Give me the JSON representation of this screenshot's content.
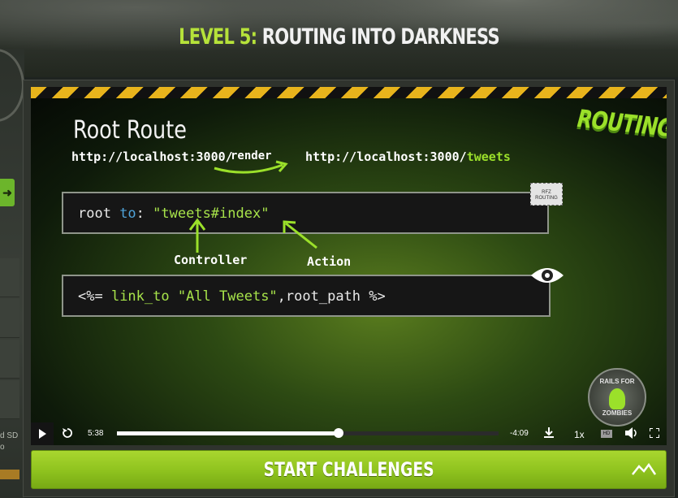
{
  "header": {
    "level_prefix": "LEVEL 5:",
    "level_name": "ROUTING INTO DARKNESS"
  },
  "sidebar": {
    "quality_text": "d SD",
    "quality_sub": "o"
  },
  "slide": {
    "title": "Root Route",
    "logo_text": "ROUTING",
    "url_from": "http://localhost:3000/",
    "render_label": "render",
    "url_to_base": "http://localhost:3000/",
    "url_to_path": "tweets",
    "code1": {
      "kw_root": "root ",
      "kw_to": "to",
      "colon": ": ",
      "string": "\"tweets#index\""
    },
    "stamp_text": "RFZ ROUTING",
    "controller_label": "Controller",
    "action_label": "Action",
    "code2": {
      "open": "<%= ",
      "method": "link_to ",
      "string": "\"All Tweets\"",
      "rest": ",root_path %>"
    },
    "badge_text": "RAILS FOR",
    "badge_sub": "ZOMBIES"
  },
  "player": {
    "current_time": "5:38",
    "remaining_time": "-4:09",
    "speed": "1x",
    "progress": 0.58,
    "icons": [
      "play-icon",
      "replay-icon",
      "download-icon",
      "hd-icon",
      "volume-icon",
      "fullscreen-icon"
    ]
  },
  "cta": {
    "label": "START CHALLENGES"
  },
  "colors": {
    "accent_green": "#b6e23a",
    "button_green": "#8ec21e",
    "hazard_yellow": "#e8b41c"
  }
}
